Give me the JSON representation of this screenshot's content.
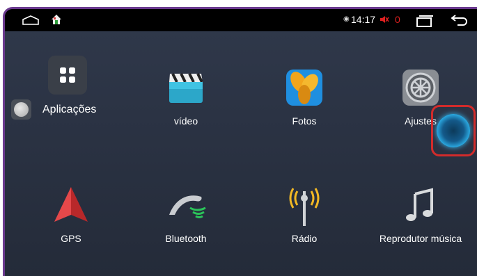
{
  "status_bar": {
    "home_icon": "home-outline-icon",
    "house_icon": "house-icon",
    "location_icon": "location-pin-icon",
    "time": "14:17",
    "mute_icon": "speaker-muted-icon",
    "notification_count": "0",
    "recent_icon": "recent-apps-icon",
    "back_icon": "back-arrow-icon"
  },
  "launcher": {
    "apps_button_label": "Aplicações",
    "apps_icon": "grid-apps-icon"
  },
  "apps": [
    {
      "label": "vídeo",
      "icon": "video-clapper-icon"
    },
    {
      "label": "Fotos",
      "icon": "photos-petals-icon"
    },
    {
      "label": "Ajustes",
      "icon": "settings-gear-icon"
    },
    {
      "label": "GPS",
      "icon": "gps-arrow-icon"
    },
    {
      "label": "Bluetooth",
      "icon": "bluetooth-phone-icon"
    },
    {
      "label": "Rádio",
      "icon": "radio-antenna-icon"
    },
    {
      "label": "Reprodutor música",
      "icon": "music-note-icon"
    }
  ],
  "colors": {
    "accent_red": "#d22b2b",
    "frame_purple": "#6b3a8f",
    "background": "#2b3344"
  }
}
